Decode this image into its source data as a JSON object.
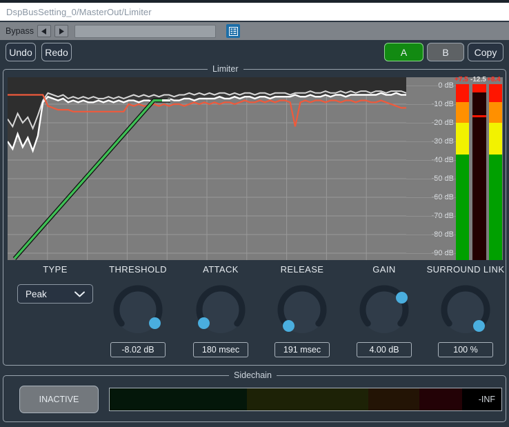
{
  "window": {
    "title": "DspBusSetting_0/MasterOut/Limiter"
  },
  "bypass": {
    "label": "Bypass",
    "prev_icon": "left-arrow-icon",
    "next_icon": "right-arrow-icon",
    "field_value": "",
    "list_icon": "list-grid-icon"
  },
  "toolbar": {
    "undo_label": "Undo",
    "redo_label": "Redo",
    "ab_a_label": "A",
    "ab_b_label": "B",
    "copy_label": "Copy",
    "active_slot": "A",
    "accent_green": "#128a12"
  },
  "limiter": {
    "legend": "Limiter",
    "scale_ticks": [
      "0 dB",
      "-10 dB",
      "-20 dB",
      "-30 dB",
      "-40 dB",
      "-50 dB",
      "-60 dB",
      "-70 dB",
      "-80 dB",
      "-90 dB"
    ],
    "meters": [
      {
        "name": "left-level",
        "value": "+7.5",
        "color": "#ff2b1e",
        "level_pct": 100
      },
      {
        "name": "gain-reduction",
        "value": "-12.5",
        "color": "#dedede",
        "level_pct": 18
      },
      {
        "name": "right-level",
        "value": "+8.4",
        "color": "#ff2b1e",
        "level_pct": 100
      }
    ],
    "curve_color": "#3fbf55",
    "threshold_color": "#ef5a3c"
  },
  "controls": [
    {
      "name": "type",
      "caption": "TYPE",
      "kind": "select",
      "value": "Peak",
      "chevron": "chevron-down-icon"
    },
    {
      "name": "threshold",
      "caption": "THRESHOLD",
      "kind": "knob",
      "value": "-8.02 dB",
      "angle": 128
    },
    {
      "name": "attack",
      "caption": "ATTACK",
      "kind": "knob",
      "value": "180 msec",
      "angle": -128
    },
    {
      "name": "release",
      "caption": "RELEASE",
      "kind": "knob",
      "value": "191 msec",
      "angle": -140
    },
    {
      "name": "gain",
      "caption": "GAIN",
      "kind": "knob",
      "value": "4.00 dB",
      "angle": 55
    },
    {
      "name": "surround-link",
      "caption": "SURROUND LINK",
      "kind": "knob",
      "value": "100 %",
      "angle": 140
    }
  ],
  "sidechain": {
    "legend": "Sidechain",
    "button_label": "INACTIVE",
    "meter_value": "-INF",
    "segments": [
      "#04170a",
      "#1d2206",
      "#231405",
      "#230206",
      "#000000"
    ]
  },
  "chart_data": {
    "type": "line",
    "title": "Limiter",
    "ylabel": "dB",
    "ylim": [
      -90,
      5
    ],
    "grid": true,
    "xlabel": "",
    "legend_position": "none",
    "yticks": [
      0,
      -10,
      -20,
      -30,
      -40,
      -50,
      -60,
      -70,
      -80,
      -90
    ],
    "series": [
      {
        "name": "peak-history",
        "color": "#d8d8d8",
        "values": [
          -18,
          -22,
          -15,
          -20,
          -17,
          -23,
          -16,
          -8,
          -4,
          -5,
          -6,
          -5,
          -7,
          -6,
          -7,
          -6,
          -7,
          -6,
          -7,
          -7,
          -6,
          -7,
          -6,
          -7,
          -6,
          -5,
          -6,
          -5,
          -6,
          -5,
          -6,
          -5,
          -5,
          -6,
          -5,
          -5,
          -4,
          -5,
          -4,
          -5,
          -4,
          -5,
          -4,
          -4,
          -5,
          -4,
          -5,
          -4,
          -4,
          -5,
          -4,
          -4,
          -5,
          -4,
          -4,
          -4,
          -5,
          -4,
          -4,
          -4,
          -3,
          -4,
          -4,
          -3,
          -4,
          -4,
          -3,
          -4,
          -3,
          -4,
          -3,
          -3,
          -4,
          -3,
          -3,
          -4,
          -3,
          -3,
          -3,
          -4
        ]
      },
      {
        "name": "rms-history",
        "color": "#ffffff",
        "values": [
          -30,
          -34,
          -26,
          -33,
          -28,
          -35,
          -27,
          -9,
          -6,
          -7,
          -8,
          -7,
          -9,
          -8,
          -9,
          -8,
          -9,
          -9,
          -8,
          -9,
          -8,
          -9,
          -8,
          -9,
          -8,
          -8,
          -9,
          -8,
          -8,
          -9,
          -8,
          -8,
          -7,
          -8,
          -8,
          -7,
          -7,
          -8,
          -7,
          -7,
          -7,
          -7,
          -6,
          -7,
          -7,
          -6,
          -7,
          -6,
          -6,
          -7,
          -6,
          -6,
          -7,
          -6,
          -6,
          -6,
          -6,
          -5,
          -6,
          -6,
          -5,
          -6,
          -6,
          -5,
          -6,
          -5,
          -5,
          -6,
          -5,
          -5,
          -5,
          -5,
          -5,
          -5,
          -4,
          -5,
          -5,
          -4,
          -5,
          -5
        ]
      },
      {
        "name": "gain-reduction-history",
        "color": "#ef5a3c",
        "values": [
          -5,
          -5,
          -5,
          -5,
          -5,
          -5,
          -5,
          -5,
          -11,
          -12,
          -13,
          -13,
          -13,
          -14,
          -14,
          -14,
          -14,
          -14,
          -14,
          -14,
          -14,
          -14,
          -14,
          -14,
          -10,
          -11,
          -10,
          -11,
          -11,
          -10,
          -11,
          -10,
          -11,
          -10,
          -10,
          -11,
          -10,
          -9,
          -10,
          -9,
          -10,
          -9,
          -10,
          -9,
          -9,
          -10,
          -9,
          -8,
          -9,
          -9,
          -8,
          -9,
          -8,
          -9,
          -8,
          -8,
          -9,
          -22,
          -9,
          -8,
          -9,
          -8,
          -8,
          -9,
          -8,
          -8,
          -9,
          -8,
          -8,
          -9,
          -8,
          -8,
          -9,
          -9,
          -8,
          -9,
          -10,
          -11,
          -12,
          -12
        ]
      },
      {
        "name": "transfer-curve",
        "color": "#3fbf55",
        "values": [
          -90,
          -8,
          -8
        ]
      }
    ]
  }
}
